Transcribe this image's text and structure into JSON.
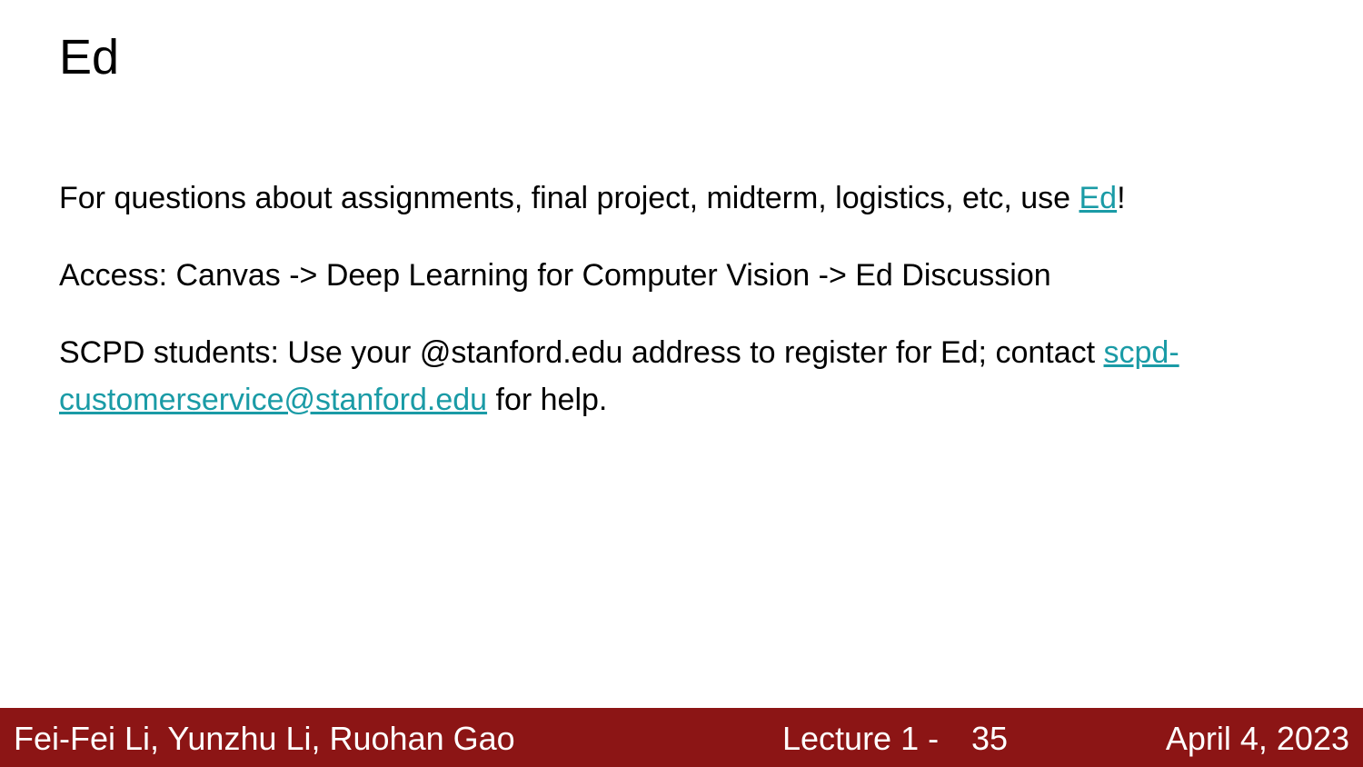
{
  "slide": {
    "title": "Ed",
    "paragraphs": {
      "p1": {
        "text_before": "For questions about assignments, final project, midterm, logistics, etc, use ",
        "link": "Ed",
        "text_after": "!"
      },
      "p2": {
        "text": "Access: Canvas -> Deep Learning for Computer Vision -> Ed Discussion"
      },
      "p3": {
        "text_before": "SCPD students: Use your @stanford.edu address to register for Ed; contact ",
        "link": "scpd-customerservice@stanford.edu",
        "text_after": " for help."
      }
    },
    "link_color": "#1a9ba6"
  },
  "footer": {
    "authors": "Fei-Fei Li, Yunzhu Li, Ruohan Gao",
    "lecture": "Lecture 1 -",
    "page": "35",
    "date": "April 4, 2023",
    "background_color": "#8c1515"
  }
}
